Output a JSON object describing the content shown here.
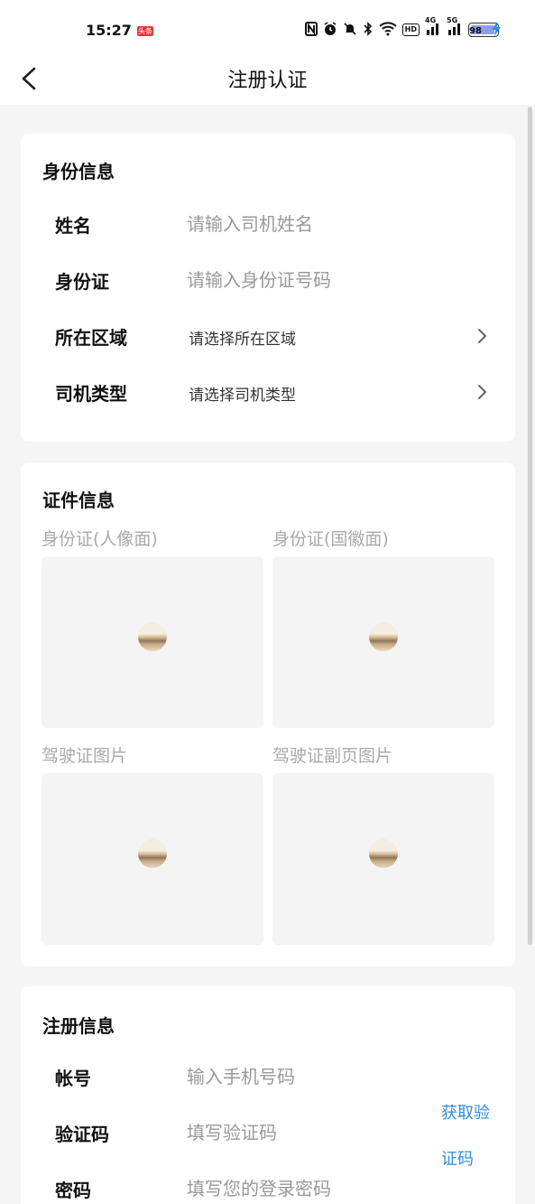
{
  "status_bar": {
    "time": "15:27",
    "badge": "头条",
    "network_4g": "4G",
    "network_5g": "5G",
    "hd_label": "HD",
    "battery": "98",
    "battery_level_percent": 98,
    "icons": [
      "nfc-icon",
      "alarm-icon",
      "mute-icon",
      "bluetooth-icon",
      "wifi-icon",
      "signal-icon",
      "charging-icon"
    ]
  },
  "nav": {
    "title": "注册认证"
  },
  "identity": {
    "title": "身份信息",
    "name_label": "姓名",
    "name_placeholder": "请输入司机姓名",
    "idcard_label": "身份证",
    "idcard_placeholder": "请输入身份证号码",
    "region_label": "所在区域",
    "region_value": "请选择所在区域",
    "type_label": "司机类型",
    "type_value": "请选择司机类型"
  },
  "documents": {
    "title": "证件信息",
    "items": [
      {
        "label": "身份证(人像面)"
      },
      {
        "label": "身份证(国徽面)"
      },
      {
        "label": "驾驶证图片"
      },
      {
        "label": "驾驶证副页图片"
      }
    ]
  },
  "register": {
    "title": "注册信息",
    "account_label": "帐号",
    "account_placeholder": "输入手机号码",
    "code_label": "验证码",
    "code_placeholder": "填写验证码",
    "get_code_line1": "获取验",
    "get_code_line2": "证码",
    "password_label": "密码",
    "password_placeholder": "填写您的登录密码"
  },
  "colors": {
    "accent": "#2f8fd6",
    "background": "#f5f5f5",
    "card": "#ffffff",
    "placeholder": "#999999"
  }
}
